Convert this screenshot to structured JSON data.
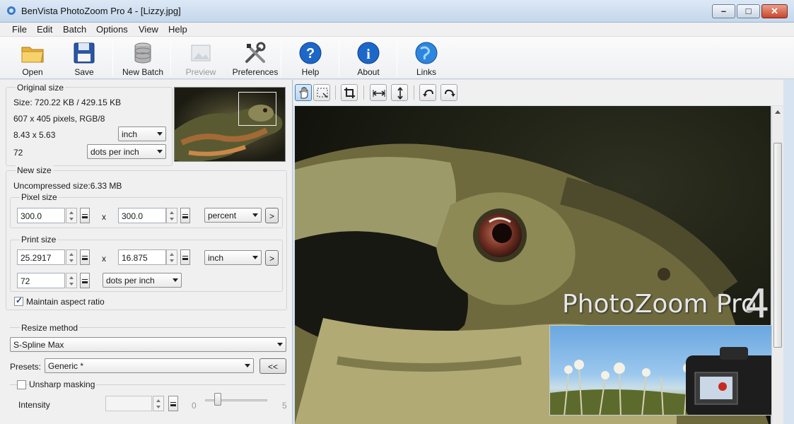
{
  "window": {
    "title": "BenVista PhotoZoom Pro 4 - [Lizzy.jpg]"
  },
  "menu": [
    "File",
    "Edit",
    "Batch",
    "Options",
    "View",
    "Help"
  ],
  "toolbar": {
    "open": "Open",
    "save": "Save",
    "new_batch": "New Batch",
    "preview": "Preview",
    "preferences": "Preferences",
    "help": "Help",
    "about": "About",
    "links": "Links"
  },
  "original": {
    "heading": "Original size",
    "size_text": "Size: 720.22 KB / 429.15 KB",
    "pixels_text": "607 x 405 pixels, RGB/8",
    "dimensions": "8.43 x 5.63",
    "unit": "inch",
    "resolution": "72",
    "res_unit": "dots per inch"
  },
  "newsize": {
    "heading": "New size",
    "uncompressed": "Uncompressed size:6.33 MB",
    "pixel_heading": "Pixel size",
    "pixel_w": "300.0",
    "pixel_h": "300.0",
    "pixel_unit": "percent",
    "x_sep": "x",
    "more": ">",
    "print_heading": "Print size",
    "print_w": "25.2917",
    "print_h": "16.875",
    "print_unit": "inch",
    "print_res": "72",
    "print_res_unit": "dots per inch",
    "maintain": "Maintain aspect ratio"
  },
  "resize": {
    "heading": "Resize method",
    "method": "S-Spline Max",
    "presets_label": "Presets:",
    "preset": "Generic *",
    "collapse": "<<"
  },
  "unsharp": {
    "label": "Unsharp masking",
    "intensity_label": "Intensity",
    "intensity_min": "0",
    "intensity_max": "5"
  },
  "brand": {
    "name": "PhotoZoom Pro",
    "version": "4"
  }
}
